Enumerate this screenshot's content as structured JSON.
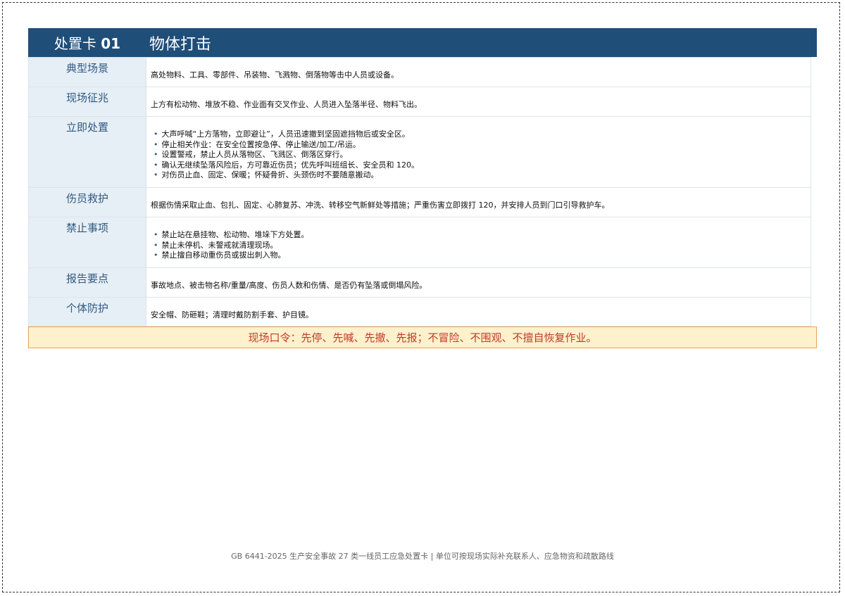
{
  "header": {
    "card_prefix": "处置卡",
    "card_number": "01",
    "title": "物体打击"
  },
  "rows": [
    {
      "label": "典型场景",
      "text": "高处物料、工具、零部件、吊装物、飞溅物、倒落物等击中人员或设备。"
    },
    {
      "label": "现场征兆",
      "text": "上方有松动物、堆放不稳、作业面有交叉作业、人员进入坠落半径、物料飞出。"
    },
    {
      "label": "立即处置",
      "items": [
        "大声呼喊“上方落物，立即避让”，人员迅速撤到坚固遮挡物后或安全区。",
        "停止相关作业：在安全位置按急停、停止输送/加工/吊运。",
        "设置警戒，禁止人员从落物区、飞溅区、倒落区穿行。",
        "确认无继续坠落风险后，方可靠近伤员；优先呼叫班组长、安全员和 120。",
        "对伤员止血、固定、保暖；怀疑骨折、头颈伤时不要随意搬动。"
      ]
    },
    {
      "label": "伤员救护",
      "text": "根据伤情采取止血、包扎、固定、心肺复苏、冲洗、转移空气新鲜处等措施；严重伤害立即拨打 120，并安排人员到门口引导救护车。"
    },
    {
      "label": "禁止事项",
      "items": [
        "禁止站在悬挂物、松动物、堆垛下方处置。",
        "禁止未停机、未警戒就清理现场。",
        "禁止擅自移动重伤员或拔出刺入物。"
      ]
    },
    {
      "label": "报告要点",
      "text": "事故地点、被击物名称/重量/高度、伤员人数和伤情、是否仍有坠落或倒塌风险。"
    },
    {
      "label": "个体防护",
      "text": "安全帽、防砸鞋；清理时戴防割手套、护目镜。"
    }
  ],
  "slogan": "现场口令：先停、先喊、先撤、先报；不冒险、不围观、不擅自恢复作业。",
  "footer": "GB 6441-2025 生产安全事故 27 类一线员工应急处置卡 | 单位可按现场实际补充联系人、应急物资和疏散路线"
}
